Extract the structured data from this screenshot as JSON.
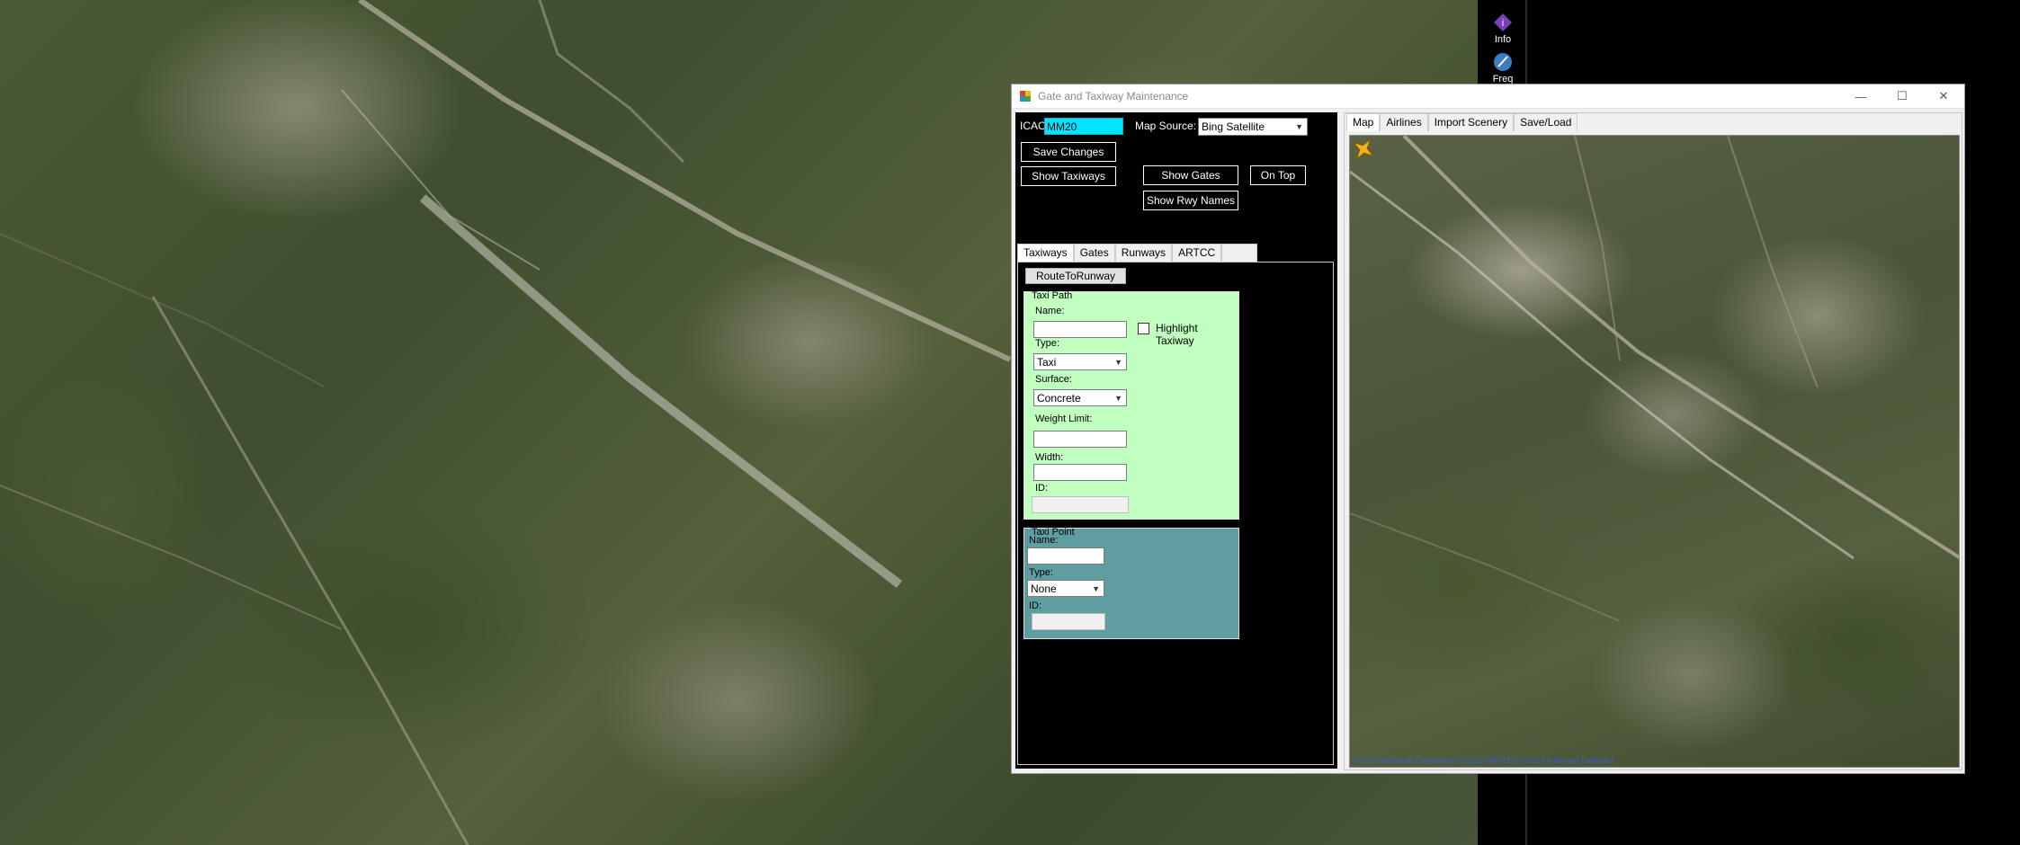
{
  "desktop": {
    "side_icons": [
      {
        "label": "Info",
        "icon": "info-icon"
      },
      {
        "label": "Freq",
        "icon": "frequency-icon"
      }
    ]
  },
  "window": {
    "title": "Gate and Taxiway Maintenance",
    "controls": {
      "minimize": "—",
      "maximize": "☐",
      "close": "✕"
    }
  },
  "toolbar": {
    "icao_label": "ICAO",
    "icao_value": "MM20",
    "map_source_label": "Map Source:",
    "map_source_value": "Bing Satellite",
    "save_changes": "Save Changes",
    "show_taxiways": "Show Taxiways",
    "show_gates": "Show Gates",
    "on_top": "On Top",
    "show_rwy_names": "Show Rwy Names"
  },
  "left_tabs": [
    "Taxiways",
    "Gates",
    "Runways",
    "ARTCC"
  ],
  "taxiways": {
    "route_button": "RouteToRunway",
    "taxi_path": {
      "legend": "Taxi Path",
      "name_label": "Name:",
      "name_value": "",
      "highlight_label": "Highlight Taxiway",
      "type_label": "Type:",
      "type_value": "Taxi",
      "surface_label": "Surface:",
      "surface_value": "Concrete",
      "weight_label": "Weight Limit:",
      "weight_value": "",
      "width_label": "Width:",
      "width_value": "",
      "id_label": "ID:",
      "id_value": ""
    },
    "taxi_point": {
      "legend": "Taxi Point",
      "name_label": "Name:",
      "name_value": "",
      "type_label": "Type:",
      "type_value": "None",
      "id_label": "ID:",
      "id_value": ""
    }
  },
  "right_tabs": [
    "Map",
    "Airlines",
    "Import Scenery",
    "Save/Load"
  ],
  "map": {
    "attribution": "©2023 Microsoft Corporation ©2023 NAVTEQ ©2023 Intermap Earthstar",
    "marker_color": "#f2b41c"
  }
}
